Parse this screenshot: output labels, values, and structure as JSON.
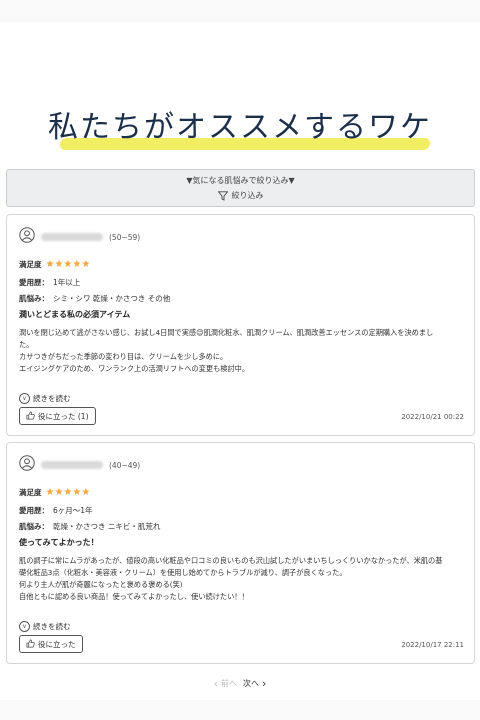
{
  "hero": {
    "title": "私たちがオススメするワケ"
  },
  "filter": {
    "title": "▼気になる肌悩みで絞り込み▼",
    "button_label": "絞り込み"
  },
  "reviews": [
    {
      "age": "(50~59)",
      "satisfaction_label": "満足度",
      "stars": "★★★★★",
      "usage_label": "愛用歴：",
      "usage_value": "1年以上",
      "concerns_label": "肌悩み：",
      "concerns_value": "シミ・シワ 乾燥・かさつき その他",
      "title": "潤いとどまる私の必須アイテム",
      "body": [
        "潤いを閉じ込めて逃がさない感じ、お試し4日間で実感😊肌潤化粧水、肌潤クリーム、肌潤改善エッセンスの定期購入を決めまし",
        "た。",
        "カサつきがちだった季節の変わり目は、クリームを少し多めに。",
        "エイジングケアのため、ワンランク上の活潤リフトへの変更も検討中。"
      ],
      "read_more": "続きを読む",
      "helpful_label": "役に立った (1)",
      "date": "2022/10/21 00:22"
    },
    {
      "age": "(40~49)",
      "satisfaction_label": "満足度",
      "stars": "★★★★★",
      "usage_label": "愛用歴：",
      "usage_value": "6ヶ月～1年",
      "concerns_label": "肌悩み：",
      "concerns_value": "乾燥・かさつき ニキビ・肌荒れ",
      "title": "使ってみてよかった！",
      "body": [
        "肌の調子に常にムラがあったが、値段の高い化粧品や口コミの良いものも沢山試したがいまいちしっくりいかなかったが、米肌の基",
        "礎化粧品3点（化粧水・美容液・クリーム）を使用し始めてからトラブルが減り、調子が良くなった。",
        "何より主人が肌が奇麗になったと褒める褒める(笑)",
        "自他ともに認める良い商品！使ってみてよかったし、使い続けたい！！"
      ],
      "read_more": "続きを読む",
      "helpful_label": "役に立った",
      "date": "2022/10/17 22:11"
    }
  ],
  "pager": {
    "prev": "前へ",
    "next": "次へ"
  },
  "colors": {
    "highlight": "#f2ee63",
    "star": "#f3a63b",
    "title": "#1c2f4a"
  }
}
